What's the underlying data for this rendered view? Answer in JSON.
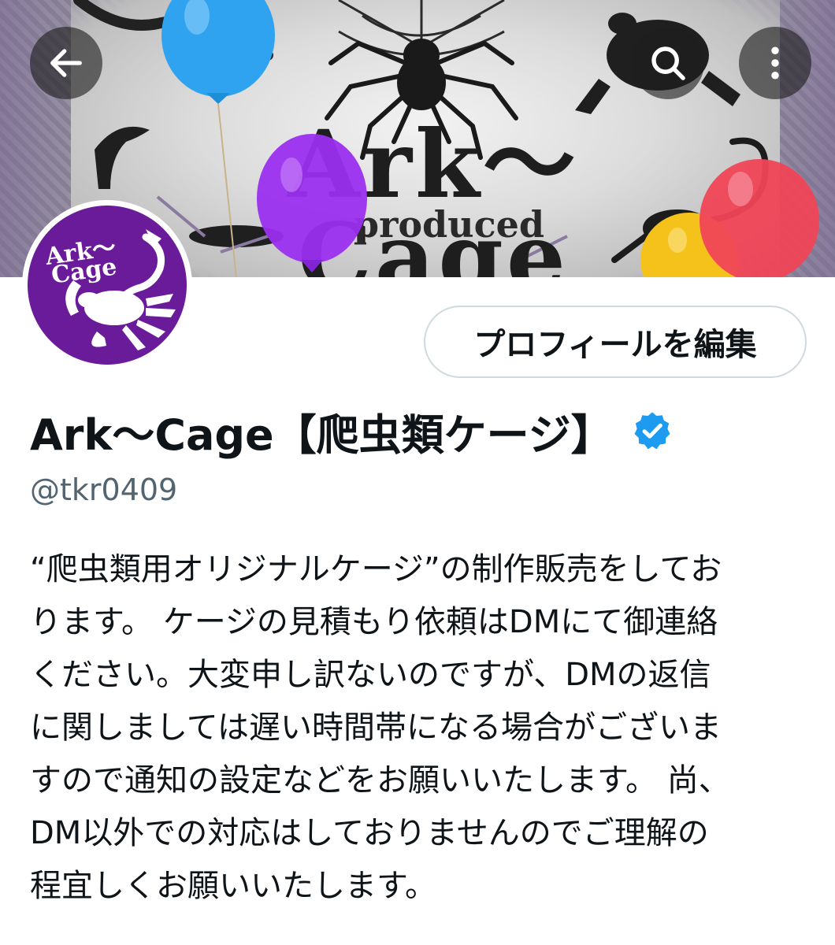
{
  "header": {
    "back_icon": "arrow-left-icon",
    "search_icon": "search-icon",
    "more_icon": "more-vertical-icon",
    "banner": {
      "title": "Ark～Cage",
      "subtitle": "produced"
    }
  },
  "avatar": {
    "line1": "Ark～",
    "line2": "Cage",
    "color": "#6a1b9a"
  },
  "actions": {
    "edit_profile_label": "プロフィールを編集"
  },
  "profile": {
    "display_name": "Ark～Cage【爬虫類ケージ】",
    "verified": true,
    "verified_color": "#1d9bf0",
    "handle": "@tkr0409",
    "bio_lines": [
      "“爬虫類用オリジナルケージ”の制作販売をしてお",
      "ります。 ケージの見積もり依頼はDMにて御連絡",
      "ください。大変申し訳ないのですが、DMの返信",
      "に関しましては遅い時間帯になる場合がございま",
      "すので通知の設定などをお願いいたします。 尚、",
      "DM以外での対応はしておりませんのでご理解の",
      "程宜しくお願いいたします。"
    ]
  }
}
